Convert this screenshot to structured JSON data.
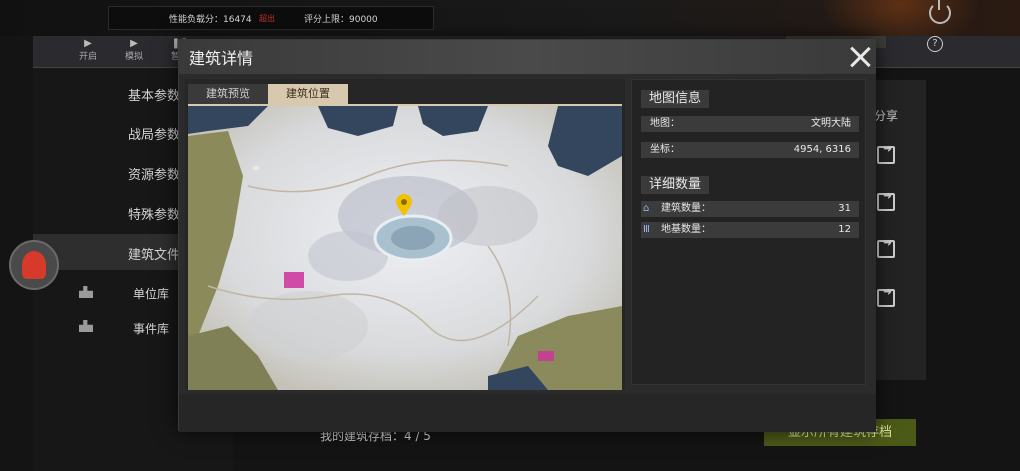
{
  "topbar": {
    "perf_score_label": "性能负载分：16474",
    "perf_score_badge": "超出",
    "score_cap_label": "评分上限：90000"
  },
  "toolbar": {
    "items": [
      {
        "label": "开启",
        "icon": "play-icon"
      },
      {
        "label": "模拟",
        "icon": "play-icon"
      },
      {
        "label": "暂停",
        "icon": "pause-icon"
      }
    ]
  },
  "sidebar": {
    "items": [
      {
        "label": "基本参数"
      },
      {
        "label": "战局参数"
      },
      {
        "label": "资源参数"
      },
      {
        "label": "特殊参数"
      },
      {
        "label": "建筑文件"
      }
    ],
    "libs": [
      {
        "label": "单位库"
      },
      {
        "label": "事件库"
      }
    ]
  },
  "right_panel": {
    "share_label": "分享"
  },
  "bottom": {
    "archive_text": "我的建筑存档：4 / 5",
    "show_all_button": "显示所有建筑存档"
  },
  "modal": {
    "title": "建筑详情",
    "tabs": [
      {
        "label": "建筑预览",
        "active": false
      },
      {
        "label": "建筑位置",
        "active": true
      }
    ],
    "map_info": {
      "title": "地图信息",
      "map_label": "地图：",
      "map_value": "文明大陆",
      "coord_label": "坐标：",
      "coord_value": "4954, 6316"
    },
    "detail_counts": {
      "title": "详细数量",
      "building_label": "建筑数量：",
      "building_value": "31",
      "foundation_label": "地基数量：",
      "foundation_value": "12"
    }
  },
  "colors": {
    "accent_tab": "#d8c8ad",
    "marker": "#f2c200",
    "button_green": "#4c5a18"
  }
}
